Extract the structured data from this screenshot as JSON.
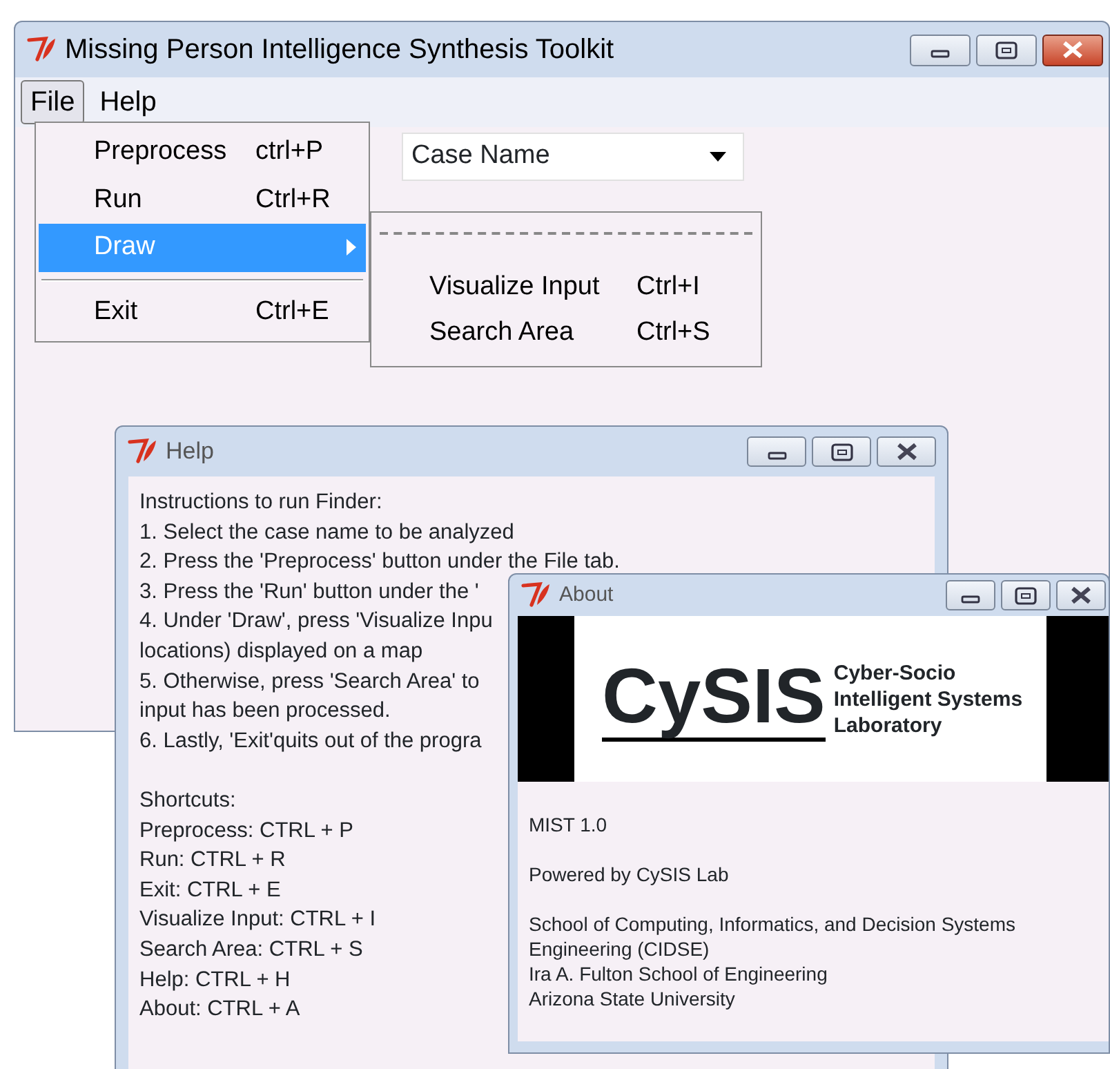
{
  "main_window": {
    "title": "Missing Person Intelligence Synthesis Toolkit",
    "active": true,
    "menu_bar": [
      {
        "label": "File",
        "selected": true
      },
      {
        "label": "Help",
        "selected": false
      }
    ],
    "file_menu": [
      {
        "kind": "command",
        "label": "Preprocess",
        "shortcut": "ctrl+P",
        "selected": false
      },
      {
        "kind": "command",
        "label": "Run",
        "shortcut": "Ctrl+R",
        "selected": false
      },
      {
        "kind": "cascade",
        "label": "Draw",
        "selected": true
      },
      {
        "kind": "separator"
      },
      {
        "kind": "command",
        "label": "Exit",
        "shortcut": "Ctrl+E",
        "selected": false
      }
    ],
    "draw_submenu": {
      "tear_off": true,
      "items": [
        {
          "label": "Visualize Input",
          "shortcut": "Ctrl+I"
        },
        {
          "label": "Search Area",
          "shortcut": "Ctrl+S"
        }
      ]
    },
    "case_combobox": {
      "value": "Case Name"
    }
  },
  "help_window": {
    "title": "Help",
    "active": false,
    "instructions": [
      "Instructions to run Finder:",
      "1. Select the case name to be analyzed",
      "2. Press the 'Preprocess' button under the File tab.",
      "3. Press the 'Run' button under the '",
      "4. Under 'Draw', press 'Visualize Inpu",
      "locations) displayed on a map",
      "5. Otherwise, press 'Search Area' to",
      "input has been processed.",
      "6. Lastly, 'Exit'quits out of the progra"
    ],
    "shortcuts": [
      "Shortcuts:",
      "Preprocess: CTRL + P",
      "Run: CTRL + R",
      "Exit: CTRL + E",
      "Visualize Input: CTRL + I",
      "Search Area: CTRL + S",
      "Help: CTRL + H",
      "About: CTRL + A"
    ]
  },
  "about_window": {
    "title": "About",
    "active": false,
    "logo": {
      "name": "CySIS",
      "lines": [
        "Cyber-Socio",
        "Intelligent Systems",
        "Laboratory"
      ]
    },
    "paragraphs": [
      [
        "MIST 1.0"
      ],
      [
        "Powered by CySIS Lab"
      ],
      [
        "School of Computing, Informatics, and Decision Systems",
        "Engineering (CIDSE)",
        "Ira A. Fulton School of Engineering",
        "Arizona State University"
      ]
    ]
  }
}
